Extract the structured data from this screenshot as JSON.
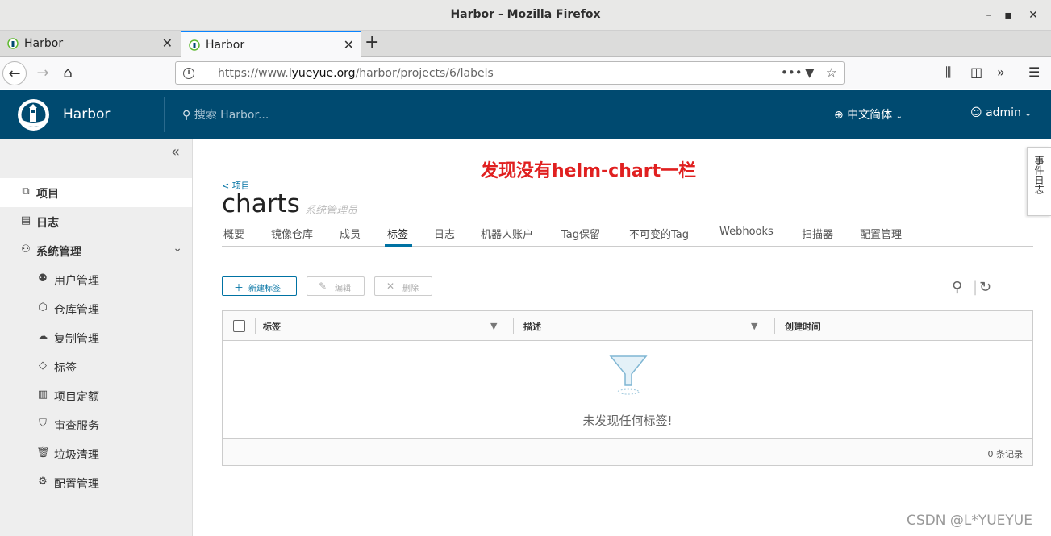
{
  "window": {
    "title": "Harbor - Mozilla Firefox"
  },
  "browser": {
    "tabs": [
      {
        "label": "Harbor",
        "active": false
      },
      {
        "label": "Harbor",
        "active": true
      }
    ],
    "url_prefix": "https://www.",
    "url_domain": "lyueyue.org",
    "url_path": "/harbor/projects/6/labels"
  },
  "header": {
    "brand": "Harbor",
    "search_placeholder": "搜索 Harbor...",
    "language": "中文简体",
    "user": "admin"
  },
  "sidebar": {
    "items": [
      {
        "label": "项目",
        "icon": "projects-icon",
        "top": true,
        "active": true
      },
      {
        "label": "日志",
        "icon": "logs-icon",
        "top": true
      },
      {
        "label": "系统管理",
        "icon": "admin-icon",
        "top": true,
        "expandable": true
      },
      {
        "label": "用户管理",
        "icon": "users-icon"
      },
      {
        "label": "仓库管理",
        "icon": "registry-icon"
      },
      {
        "label": "复制管理",
        "icon": "replication-icon"
      },
      {
        "label": "标签",
        "icon": "tag-icon"
      },
      {
        "label": "项目定额",
        "icon": "quota-icon"
      },
      {
        "label": "审查服务",
        "icon": "shield-icon"
      },
      {
        "label": "垃圾清理",
        "icon": "trash-icon"
      },
      {
        "label": "配置管理",
        "icon": "gear-icon"
      }
    ]
  },
  "annotation": "发现没有helm-chart一栏",
  "project": {
    "breadcrumb": "< 项目",
    "name": "charts",
    "role": "系统管理员"
  },
  "project_tabs": [
    "概要",
    "镜像仓库",
    "成员",
    "标签",
    "日志",
    "机器人账户",
    "Tag保留",
    "不可变的Tag",
    "Webhooks",
    "扫描器",
    "配置管理"
  ],
  "active_tab": "标签",
  "actions": {
    "new_label": "新建标签",
    "edit": "编辑",
    "delete": "删除"
  },
  "grid": {
    "columns": [
      "标签",
      "描述",
      "创建时间"
    ],
    "empty_text": "未发现任何标签!",
    "footer": "0 条记录"
  },
  "event_log": "事件日志",
  "watermark": "CSDN @L*YUEYUE",
  "colors": {
    "header": "#004a70",
    "accent": "#0072a3",
    "annotation": "#e02020"
  }
}
